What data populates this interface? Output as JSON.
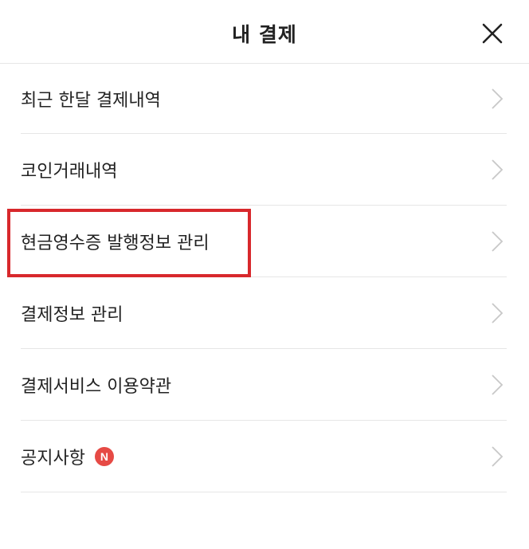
{
  "header": {
    "title": "내 결제",
    "close_icon": "close-icon"
  },
  "menu": {
    "items": [
      {
        "label": "최근 한달 결제내역",
        "icon": "chevron-right-icon"
      },
      {
        "label": "코인거래내역",
        "icon": "chevron-right-icon"
      },
      {
        "label": "현금영수증 발행정보 관리",
        "icon": "chevron-right-icon"
      },
      {
        "label": "결제정보 관리",
        "icon": "chevron-right-icon"
      },
      {
        "label": "결제서비스 이용약관",
        "icon": "chevron-right-icon"
      },
      {
        "label": "공지사항",
        "badge": "N",
        "icon": "chevron-right-icon"
      }
    ]
  },
  "colors": {
    "text": "#222222",
    "divider": "#e6e6e6",
    "chevron": "#c8c8c8",
    "badge": "#e64a45",
    "highlight": "#d8282c"
  }
}
